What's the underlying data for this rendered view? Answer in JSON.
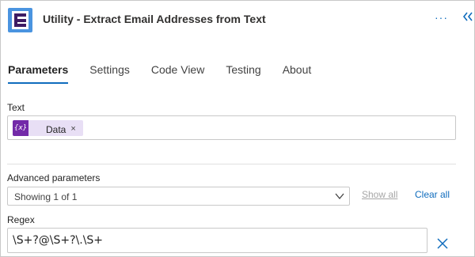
{
  "header": {
    "title": "Utility - Extract Email Addresses from Text",
    "more_label": "···",
    "icon": "utility-app-icon",
    "more_icon": "ellipsis-icon",
    "collapse_icon": "double-chevron-left-icon"
  },
  "tabs": [
    {
      "label": "Parameters",
      "active": true
    },
    {
      "label": "Settings",
      "active": false
    },
    {
      "label": "Code View",
      "active": false
    },
    {
      "label": "Testing",
      "active": false
    },
    {
      "label": "About",
      "active": false
    }
  ],
  "text_field": {
    "label": "Text",
    "token": {
      "icon_text": "{x}",
      "label": "Data",
      "close": "×"
    }
  },
  "advanced": {
    "label": "Advanced parameters",
    "selected": "Showing 1 of 1",
    "show_all": "Show all",
    "clear_all": "Clear all"
  },
  "regex": {
    "label": "Regex",
    "value": "\\S+?@\\S+?\\.\\S+"
  },
  "colors": {
    "accent": "#0f6cbd",
    "token_bg": "#e8dff5",
    "token_icon": "#732aa8",
    "brand_icon": "#4a94e0"
  }
}
